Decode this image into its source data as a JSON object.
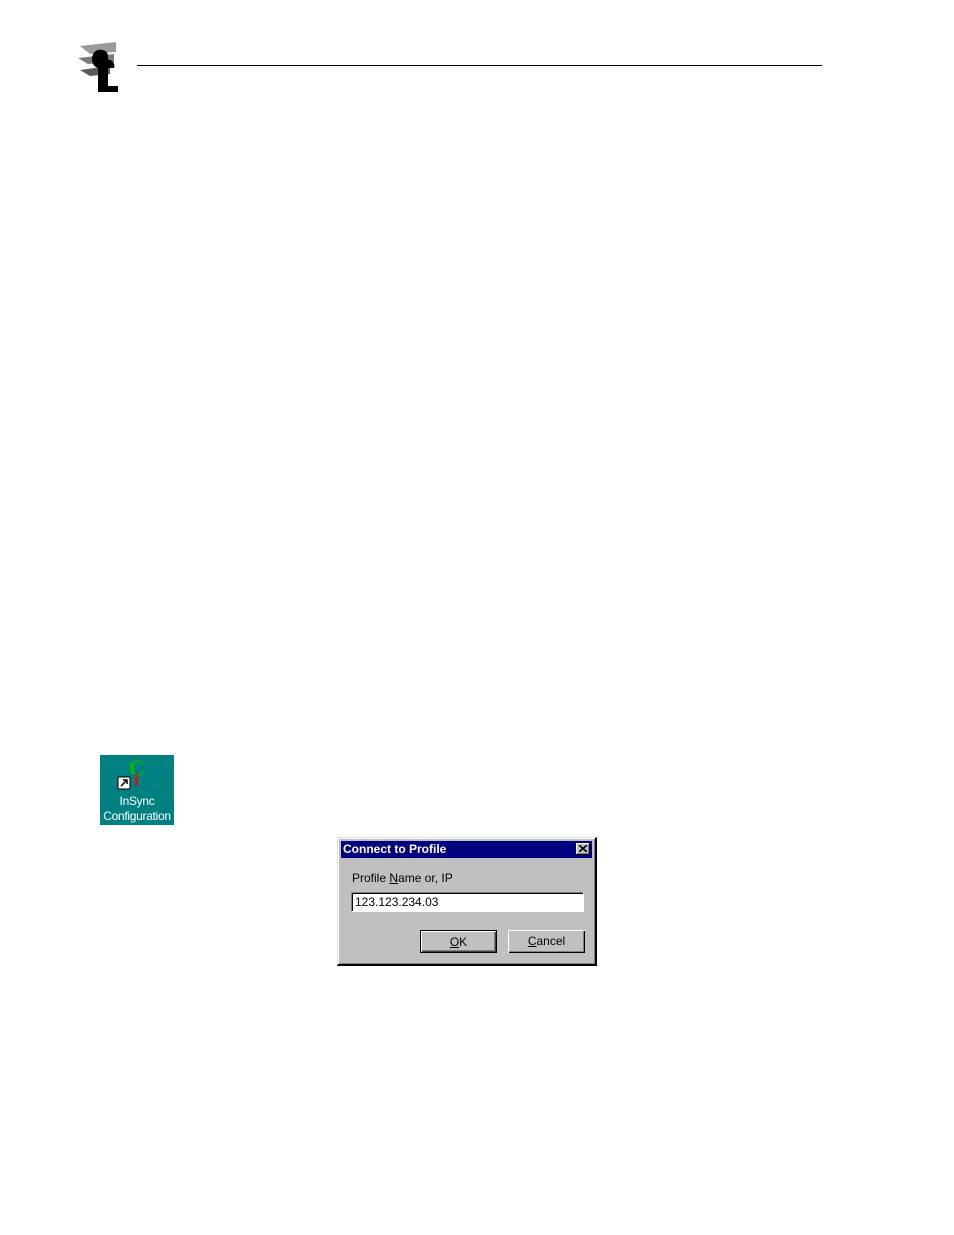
{
  "desktop_icon": {
    "label_line1": "InSync",
    "label_line2": "Configuration",
    "icon": "insync-app-icon",
    "background": "#008080"
  },
  "dialog": {
    "title": "Connect to Profile",
    "field_label_prefix": "Profile ",
    "field_label_mnemonic": "N",
    "field_label_suffix": "ame or, IP",
    "input_value": "123.123.234.03",
    "ok_mnemonic": "O",
    "ok_rest": "K",
    "cancel_mnemonic": "C",
    "cancel_rest": "ancel",
    "titlebar_color": "#000080",
    "body_color": "#c0c0c0"
  },
  "header": {
    "logo_icon": "publisher-logo-icon"
  }
}
